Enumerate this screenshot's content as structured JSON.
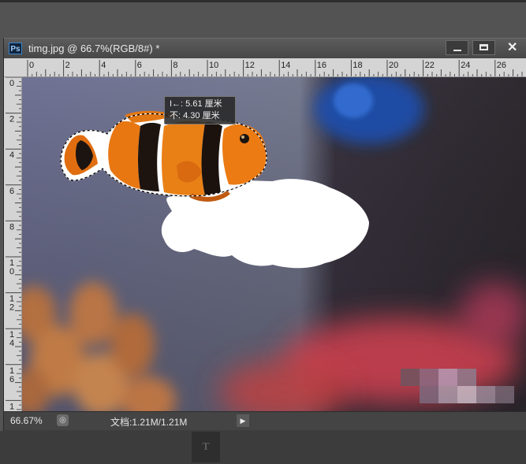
{
  "window": {
    "app_icon_label": "Ps",
    "title": "timg.jpg @ 66.7%(RGB/8#) *",
    "minimize_icon": "minimize-icon",
    "maximize_icon": "maximize-icon",
    "close_icon": "close-icon"
  },
  "ruler": {
    "top_labels": [
      "0",
      "2",
      "4",
      "6",
      "8",
      "10",
      "12",
      "14",
      "16",
      "18",
      "20",
      "22",
      "24",
      "26"
    ],
    "left_labels": [
      [
        "0"
      ],
      [
        "2"
      ],
      [
        "4"
      ],
      [
        "6"
      ],
      [
        "8"
      ],
      [
        "1",
        "0"
      ],
      [
        "1",
        "2"
      ],
      [
        "1",
        "4"
      ],
      [
        "1",
        "6"
      ],
      [
        "1"
      ]
    ]
  },
  "measure_tooltip": {
    "width_line": "I←: 5.61 厘米",
    "height_line": "不: 4.30 厘米"
  },
  "status": {
    "zoom": "66.67%",
    "doc_info": "文档:1.21M/1.21M",
    "play_icon": "play-icon",
    "status_icon": "status-icon"
  },
  "toolbar_bottom": {
    "type_tool_glyph": "T"
  }
}
